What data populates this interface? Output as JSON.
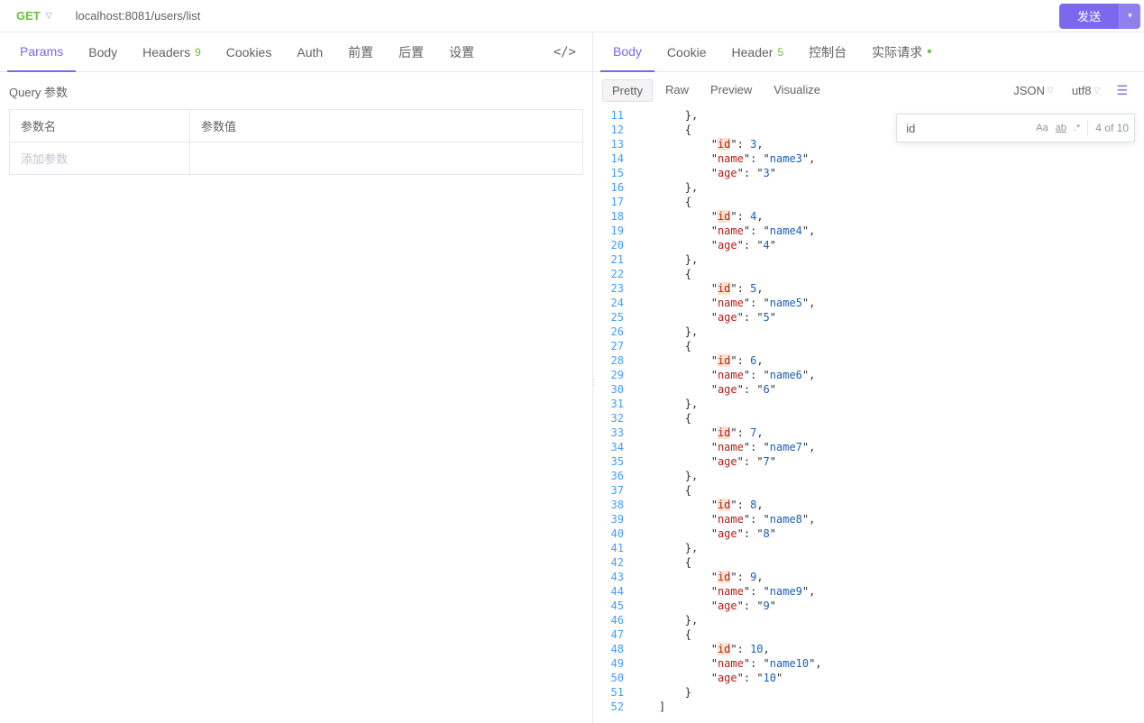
{
  "topbar": {
    "method": "GET",
    "url": "localhost:8081/users/list",
    "send": "发送"
  },
  "left_tabs": [
    {
      "key": "params",
      "label": "Params",
      "active": true
    },
    {
      "key": "body",
      "label": "Body"
    },
    {
      "key": "headers",
      "label": "Headers",
      "badge": "9"
    },
    {
      "key": "cookies",
      "label": "Cookies"
    },
    {
      "key": "auth",
      "label": "Auth"
    },
    {
      "key": "pre",
      "label": "前置"
    },
    {
      "key": "post",
      "label": "后置"
    },
    {
      "key": "settings",
      "label": "设置"
    }
  ],
  "query": {
    "title": "Query 参数",
    "h_name": "参数名",
    "h_value": "参数值",
    "add": "添加参数"
  },
  "right_tabs": [
    {
      "key": "body",
      "label": "Body",
      "active": true
    },
    {
      "key": "cookie",
      "label": "Cookie"
    },
    {
      "key": "header",
      "label": "Header",
      "badge": "5"
    },
    {
      "key": "console",
      "label": "控制台"
    },
    {
      "key": "actual",
      "label": "实际请求",
      "dot": true
    }
  ],
  "subtabs": [
    {
      "key": "pretty",
      "label": "Pretty",
      "active": true
    },
    {
      "key": "raw",
      "label": "Raw"
    },
    {
      "key": "preview",
      "label": "Preview"
    },
    {
      "key": "visualize",
      "label": "Visualize"
    }
  ],
  "format": "JSON",
  "encoding": "utf8",
  "search": {
    "value": "id",
    "count": "4 of 10",
    "opt_aa": "Aa",
    "opt_ab": "ab",
    "opt_re": ".*"
  },
  "lines": [
    {
      "n": 11,
      "ind": 2,
      "seg": [
        {
          "t": "pun",
          "v": "},"
        }
      ]
    },
    {
      "n": 12,
      "ind": 2,
      "seg": [
        {
          "t": "pun",
          "v": "{"
        }
      ]
    },
    {
      "n": 13,
      "ind": 3,
      "seg": [
        {
          "t": "q",
          "v": "\""
        },
        {
          "t": "hl",
          "v": "id"
        },
        {
          "t": "q",
          "v": "\""
        },
        {
          "t": "pun",
          "v": ": "
        },
        {
          "t": "num",
          "v": "3"
        },
        {
          "t": "pun",
          "v": ","
        }
      ]
    },
    {
      "n": 14,
      "ind": 3,
      "seg": [
        {
          "t": "q",
          "v": "\""
        },
        {
          "t": "key",
          "v": "name"
        },
        {
          "t": "q",
          "v": "\""
        },
        {
          "t": "pun",
          "v": ": "
        },
        {
          "t": "q",
          "v": "\""
        },
        {
          "t": "str",
          "v": "name3"
        },
        {
          "t": "q",
          "v": "\""
        },
        {
          "t": "pun",
          "v": ","
        }
      ]
    },
    {
      "n": 15,
      "ind": 3,
      "seg": [
        {
          "t": "q",
          "v": "\""
        },
        {
          "t": "key",
          "v": "age"
        },
        {
          "t": "q",
          "v": "\""
        },
        {
          "t": "pun",
          "v": ": "
        },
        {
          "t": "q",
          "v": "\""
        },
        {
          "t": "str",
          "v": "3"
        },
        {
          "t": "q",
          "v": "\""
        }
      ]
    },
    {
      "n": 16,
      "ind": 2,
      "seg": [
        {
          "t": "pun",
          "v": "},"
        }
      ]
    },
    {
      "n": 17,
      "ind": 2,
      "seg": [
        {
          "t": "pun",
          "v": "{"
        }
      ]
    },
    {
      "n": 18,
      "ind": 3,
      "seg": [
        {
          "t": "q",
          "v": "\""
        },
        {
          "t": "hl",
          "v": "id"
        },
        {
          "t": "q",
          "v": "\""
        },
        {
          "t": "pun",
          "v": ": "
        },
        {
          "t": "num",
          "v": "4"
        },
        {
          "t": "pun",
          "v": ","
        }
      ]
    },
    {
      "n": 19,
      "ind": 3,
      "seg": [
        {
          "t": "q",
          "v": "\""
        },
        {
          "t": "key",
          "v": "name"
        },
        {
          "t": "q",
          "v": "\""
        },
        {
          "t": "pun",
          "v": ": "
        },
        {
          "t": "q",
          "v": "\""
        },
        {
          "t": "str",
          "v": "name4"
        },
        {
          "t": "q",
          "v": "\""
        },
        {
          "t": "pun",
          "v": ","
        }
      ]
    },
    {
      "n": 20,
      "ind": 3,
      "seg": [
        {
          "t": "q",
          "v": "\""
        },
        {
          "t": "key",
          "v": "age"
        },
        {
          "t": "q",
          "v": "\""
        },
        {
          "t": "pun",
          "v": ": "
        },
        {
          "t": "q",
          "v": "\""
        },
        {
          "t": "str",
          "v": "4"
        },
        {
          "t": "q",
          "v": "\""
        }
      ]
    },
    {
      "n": 21,
      "ind": 2,
      "seg": [
        {
          "t": "pun",
          "v": "},"
        }
      ]
    },
    {
      "n": 22,
      "ind": 2,
      "seg": [
        {
          "t": "pun",
          "v": "{"
        }
      ]
    },
    {
      "n": 23,
      "ind": 3,
      "seg": [
        {
          "t": "q",
          "v": "\""
        },
        {
          "t": "hl",
          "v": "id"
        },
        {
          "t": "q",
          "v": "\""
        },
        {
          "t": "pun",
          "v": ": "
        },
        {
          "t": "num",
          "v": "5"
        },
        {
          "t": "pun",
          "v": ","
        }
      ]
    },
    {
      "n": 24,
      "ind": 3,
      "seg": [
        {
          "t": "q",
          "v": "\""
        },
        {
          "t": "key",
          "v": "name"
        },
        {
          "t": "q",
          "v": "\""
        },
        {
          "t": "pun",
          "v": ": "
        },
        {
          "t": "q",
          "v": "\""
        },
        {
          "t": "str",
          "v": "name5"
        },
        {
          "t": "q",
          "v": "\""
        },
        {
          "t": "pun",
          "v": ","
        }
      ]
    },
    {
      "n": 25,
      "ind": 3,
      "seg": [
        {
          "t": "q",
          "v": "\""
        },
        {
          "t": "key",
          "v": "age"
        },
        {
          "t": "q",
          "v": "\""
        },
        {
          "t": "pun",
          "v": ": "
        },
        {
          "t": "q",
          "v": "\""
        },
        {
          "t": "str",
          "v": "5"
        },
        {
          "t": "q",
          "v": "\""
        }
      ]
    },
    {
      "n": 26,
      "ind": 2,
      "seg": [
        {
          "t": "pun",
          "v": "},"
        }
      ]
    },
    {
      "n": 27,
      "ind": 2,
      "seg": [
        {
          "t": "pun",
          "v": "{"
        }
      ]
    },
    {
      "n": 28,
      "ind": 3,
      "seg": [
        {
          "t": "q",
          "v": "\""
        },
        {
          "t": "hl",
          "v": "id"
        },
        {
          "t": "q",
          "v": "\""
        },
        {
          "t": "pun",
          "v": ": "
        },
        {
          "t": "num",
          "v": "6"
        },
        {
          "t": "pun",
          "v": ","
        }
      ]
    },
    {
      "n": 29,
      "ind": 3,
      "seg": [
        {
          "t": "q",
          "v": "\""
        },
        {
          "t": "key",
          "v": "name"
        },
        {
          "t": "q",
          "v": "\""
        },
        {
          "t": "pun",
          "v": ": "
        },
        {
          "t": "q",
          "v": "\""
        },
        {
          "t": "str",
          "v": "name6"
        },
        {
          "t": "q",
          "v": "\""
        },
        {
          "t": "pun",
          "v": ","
        }
      ]
    },
    {
      "n": 30,
      "ind": 3,
      "seg": [
        {
          "t": "q",
          "v": "\""
        },
        {
          "t": "key",
          "v": "age"
        },
        {
          "t": "q",
          "v": "\""
        },
        {
          "t": "pun",
          "v": ": "
        },
        {
          "t": "q",
          "v": "\""
        },
        {
          "t": "str",
          "v": "6"
        },
        {
          "t": "q",
          "v": "\""
        }
      ]
    },
    {
      "n": 31,
      "ind": 2,
      "seg": [
        {
          "t": "pun",
          "v": "},"
        }
      ]
    },
    {
      "n": 32,
      "ind": 2,
      "seg": [
        {
          "t": "pun",
          "v": "{"
        }
      ]
    },
    {
      "n": 33,
      "ind": 3,
      "seg": [
        {
          "t": "q",
          "v": "\""
        },
        {
          "t": "hl",
          "v": "id"
        },
        {
          "t": "q",
          "v": "\""
        },
        {
          "t": "pun",
          "v": ": "
        },
        {
          "t": "num",
          "v": "7"
        },
        {
          "t": "pun",
          "v": ","
        }
      ]
    },
    {
      "n": 34,
      "ind": 3,
      "seg": [
        {
          "t": "q",
          "v": "\""
        },
        {
          "t": "key",
          "v": "name"
        },
        {
          "t": "q",
          "v": "\""
        },
        {
          "t": "pun",
          "v": ": "
        },
        {
          "t": "q",
          "v": "\""
        },
        {
          "t": "str",
          "v": "name7"
        },
        {
          "t": "q",
          "v": "\""
        },
        {
          "t": "pun",
          "v": ","
        }
      ]
    },
    {
      "n": 35,
      "ind": 3,
      "seg": [
        {
          "t": "q",
          "v": "\""
        },
        {
          "t": "key",
          "v": "age"
        },
        {
          "t": "q",
          "v": "\""
        },
        {
          "t": "pun",
          "v": ": "
        },
        {
          "t": "q",
          "v": "\""
        },
        {
          "t": "str",
          "v": "7"
        },
        {
          "t": "q",
          "v": "\""
        }
      ]
    },
    {
      "n": 36,
      "ind": 2,
      "seg": [
        {
          "t": "pun",
          "v": "},"
        }
      ]
    },
    {
      "n": 37,
      "ind": 2,
      "seg": [
        {
          "t": "pun",
          "v": "{"
        }
      ]
    },
    {
      "n": 38,
      "ind": 3,
      "seg": [
        {
          "t": "q",
          "v": "\""
        },
        {
          "t": "hl",
          "v": "id"
        },
        {
          "t": "q",
          "v": "\""
        },
        {
          "t": "pun",
          "v": ": "
        },
        {
          "t": "num",
          "v": "8"
        },
        {
          "t": "pun",
          "v": ","
        }
      ]
    },
    {
      "n": 39,
      "ind": 3,
      "seg": [
        {
          "t": "q",
          "v": "\""
        },
        {
          "t": "key",
          "v": "name"
        },
        {
          "t": "q",
          "v": "\""
        },
        {
          "t": "pun",
          "v": ": "
        },
        {
          "t": "q",
          "v": "\""
        },
        {
          "t": "str",
          "v": "name8"
        },
        {
          "t": "q",
          "v": "\""
        },
        {
          "t": "pun",
          "v": ","
        }
      ]
    },
    {
      "n": 40,
      "ind": 3,
      "seg": [
        {
          "t": "q",
          "v": "\""
        },
        {
          "t": "key",
          "v": "age"
        },
        {
          "t": "q",
          "v": "\""
        },
        {
          "t": "pun",
          "v": ": "
        },
        {
          "t": "q",
          "v": "\""
        },
        {
          "t": "str",
          "v": "8"
        },
        {
          "t": "q",
          "v": "\""
        }
      ]
    },
    {
      "n": 41,
      "ind": 2,
      "seg": [
        {
          "t": "pun",
          "v": "},"
        }
      ]
    },
    {
      "n": 42,
      "ind": 2,
      "seg": [
        {
          "t": "pun",
          "v": "{"
        }
      ]
    },
    {
      "n": 43,
      "ind": 3,
      "seg": [
        {
          "t": "q",
          "v": "\""
        },
        {
          "t": "hl",
          "v": "id"
        },
        {
          "t": "q",
          "v": "\""
        },
        {
          "t": "pun",
          "v": ": "
        },
        {
          "t": "num",
          "v": "9"
        },
        {
          "t": "pun",
          "v": ","
        }
      ]
    },
    {
      "n": 44,
      "ind": 3,
      "seg": [
        {
          "t": "q",
          "v": "\""
        },
        {
          "t": "key",
          "v": "name"
        },
        {
          "t": "q",
          "v": "\""
        },
        {
          "t": "pun",
          "v": ": "
        },
        {
          "t": "q",
          "v": "\""
        },
        {
          "t": "str",
          "v": "name9"
        },
        {
          "t": "q",
          "v": "\""
        },
        {
          "t": "pun",
          "v": ","
        }
      ]
    },
    {
      "n": 45,
      "ind": 3,
      "seg": [
        {
          "t": "q",
          "v": "\""
        },
        {
          "t": "key",
          "v": "age"
        },
        {
          "t": "q",
          "v": "\""
        },
        {
          "t": "pun",
          "v": ": "
        },
        {
          "t": "q",
          "v": "\""
        },
        {
          "t": "str",
          "v": "9"
        },
        {
          "t": "q",
          "v": "\""
        }
      ]
    },
    {
      "n": 46,
      "ind": 2,
      "seg": [
        {
          "t": "pun",
          "v": "},"
        }
      ]
    },
    {
      "n": 47,
      "ind": 2,
      "seg": [
        {
          "t": "pun",
          "v": "{"
        }
      ]
    },
    {
      "n": 48,
      "ind": 3,
      "seg": [
        {
          "t": "q",
          "v": "\""
        },
        {
          "t": "hl",
          "v": "id"
        },
        {
          "t": "q",
          "v": "\""
        },
        {
          "t": "pun",
          "v": ": "
        },
        {
          "t": "num",
          "v": "10"
        },
        {
          "t": "pun",
          "v": ","
        }
      ]
    },
    {
      "n": 49,
      "ind": 3,
      "seg": [
        {
          "t": "q",
          "v": "\""
        },
        {
          "t": "key",
          "v": "name"
        },
        {
          "t": "q",
          "v": "\""
        },
        {
          "t": "pun",
          "v": ": "
        },
        {
          "t": "q",
          "v": "\""
        },
        {
          "t": "str",
          "v": "name10"
        },
        {
          "t": "q",
          "v": "\""
        },
        {
          "t": "pun",
          "v": ","
        }
      ]
    },
    {
      "n": 50,
      "ind": 3,
      "seg": [
        {
          "t": "q",
          "v": "\""
        },
        {
          "t": "key",
          "v": "age"
        },
        {
          "t": "q",
          "v": "\""
        },
        {
          "t": "pun",
          "v": ": "
        },
        {
          "t": "q",
          "v": "\""
        },
        {
          "t": "str",
          "v": "10"
        },
        {
          "t": "q",
          "v": "\""
        }
      ]
    },
    {
      "n": 51,
      "ind": 2,
      "seg": [
        {
          "t": "pun",
          "v": "}"
        }
      ]
    },
    {
      "n": 52,
      "ind": 1,
      "seg": [
        {
          "t": "pun",
          "v": "]"
        }
      ]
    }
  ]
}
